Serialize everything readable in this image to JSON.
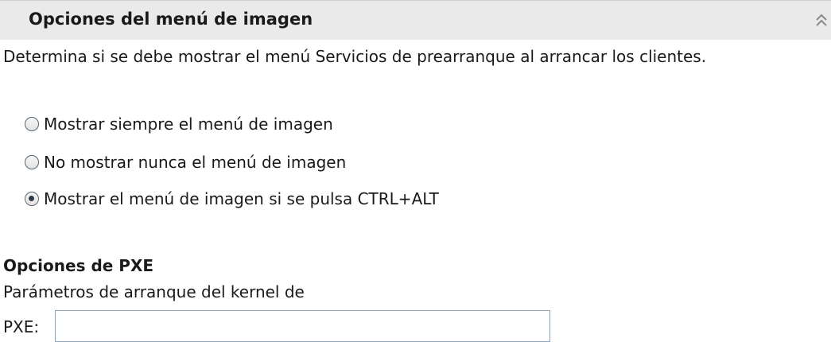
{
  "panel": {
    "title": "Opciones del menú de imagen",
    "collapse_icon": "double-chevron-up-icon"
  },
  "description": "Determina si se debe mostrar el menú Servicios de prearranque al arrancar los clientes.",
  "menu_options": [
    {
      "label": "Mostrar siempre el menú de imagen",
      "selected": false
    },
    {
      "label": "No mostrar nunca el menú de imagen",
      "selected": false
    },
    {
      "label": "Mostrar el menú de imagen si se pulsa CTRL+ALT",
      "selected": true
    }
  ],
  "pxe": {
    "section_title": "Opciones de PXE",
    "kernel_label_line1": "Parámetros de arranque del kernel de",
    "kernel_label_line2": "PXE:",
    "kernel_value": ""
  }
}
